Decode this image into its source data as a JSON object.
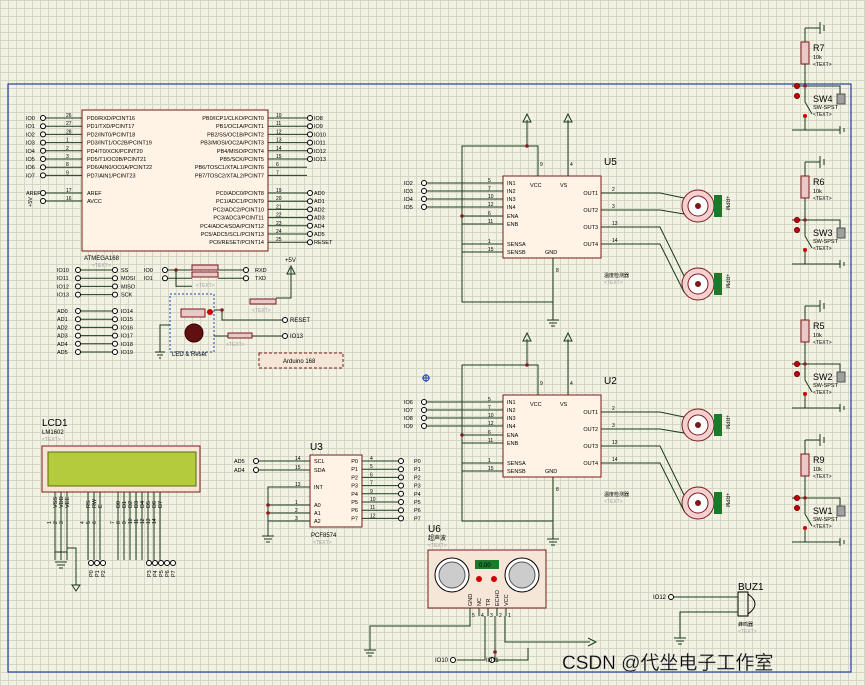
{
  "frame_color": "#1f3f9f",
  "arduino": {
    "part": "ATMEGA168",
    "tag": "<TEXT>",
    "left_pins": [
      {
        "net": "IO0",
        "num": "26",
        "name": "PD0/RXD/PCINT16"
      },
      {
        "net": "IO1",
        "num": "27",
        "name": "PD1/TXD/PCINT17"
      },
      {
        "net": "IO2",
        "num": "28",
        "name": "PD2/INT0/PCINT18"
      },
      {
        "net": "IO3",
        "num": "1",
        "name": "PD3/INT1/OC2B/PCINT19"
      },
      {
        "net": "IO4",
        "num": "2",
        "name": "PD4/T0/XCK/PCINT20"
      },
      {
        "net": "IO5",
        "num": "3",
        "name": "PD5/T1/OC0B/PCINT21"
      },
      {
        "net": "IO6",
        "num": "8",
        "name": "PD6/AIN0/OC0A/PCINT22"
      },
      {
        "net": "IO7",
        "num": "9",
        "name": "PD7/AIN1/PCINT23"
      },
      {
        "net": "AREF",
        "num": "17",
        "name": "AREF"
      },
      {
        "net": "+5V",
        "num": "16",
        "name": "AVCC"
      }
    ],
    "right_pins": [
      {
        "net": "IO8",
        "num": "10",
        "name": "PB0/ICP1/CLKO/PCINT0"
      },
      {
        "net": "IO9",
        "num": "11",
        "name": "PB1/OC1A/PCINT1"
      },
      {
        "net": "IO10",
        "num": "12",
        "name": "PB2/SS/OC1B/PCINT2"
      },
      {
        "net": "IO11",
        "num": "13",
        "name": "PB3/MOSI/OC2A/PCINT3"
      },
      {
        "net": "IO12",
        "num": "14",
        "name": "PB4/MISO/PCINT4"
      },
      {
        "net": "IO13",
        "num": "15",
        "name": "PB5/SCK/PCINT5"
      },
      {
        "net": "",
        "num": "6",
        "name": "PB6/TOSC1/XTAL1/PCINT6"
      },
      {
        "net": "",
        "num": "7",
        "name": "PB7/TOSC2/XTAL2/PCINT7"
      },
      {
        "net": "AD0",
        "num": "19",
        "name": "PC0/ADC0/PCINT8"
      },
      {
        "net": "AD1",
        "num": "20",
        "name": "PC1/ADC1/PCINT9"
      },
      {
        "net": "AD2",
        "num": "21",
        "name": "PC2/ADC2/PCINT10"
      },
      {
        "net": "AD3",
        "num": "22",
        "name": "PC3/ADC3/PCINT11"
      },
      {
        "net": "AD4",
        "num": "23",
        "name": "PC4/ADC4/SDA/PCINT12"
      },
      {
        "net": "AD5",
        "num": "24",
        "name": "PC5/ADC5/SCL/PCINT13"
      },
      {
        "net": "RESET",
        "num": "25",
        "name": "PC6/RESET/PCINT14"
      }
    ],
    "spi_map": [
      {
        "from": "IO10",
        "to": "SS"
      },
      {
        "from": "IO11",
        "to": "MOSI"
      },
      {
        "from": "IO12",
        "to": "MISO"
      },
      {
        "from": "IO13",
        "to": "SCK"
      }
    ],
    "uart_map": [
      {
        "from": "IO0",
        "to": "RXD"
      },
      {
        "from": "IO1",
        "to": "TXD"
      }
    ],
    "analog_map": [
      {
        "from": "AD0",
        "to": "IO14"
      },
      {
        "from": "AD1",
        "to": "IO15"
      },
      {
        "from": "AD2",
        "to": "IO16"
      },
      {
        "from": "AD3",
        "to": "IO17"
      },
      {
        "from": "AD4",
        "to": "IO18"
      },
      {
        "from": "AD5",
        "to": "IO19"
      }
    ],
    "plus5v": "+5V",
    "reset": "RESET",
    "io13": "IO13",
    "led_reset_label": "LED & Reset",
    "board_label": "Arduino 168",
    "text_tag": "<TEXT>"
  },
  "u5": {
    "ref": "U5",
    "title": "温度检测器",
    "tag": "<TEXT>",
    "inputs": [
      "IO2",
      "IO3",
      "IO4",
      "IO5"
    ],
    "left_pins": [
      {
        "num": "5",
        "name": "IN1"
      },
      {
        "num": "7",
        "name": "IN2"
      },
      {
        "num": "10",
        "name": "IN3"
      },
      {
        "num": "12",
        "name": "IN4"
      },
      {
        "num": "6",
        "name": "ENA"
      },
      {
        "num": "11",
        "name": "ENB"
      },
      {
        "num": "1",
        "name": "SENSA"
      },
      {
        "num": "15",
        "name": "SENSB"
      }
    ],
    "top_pins": [
      {
        "num": "9",
        "name": "VCC"
      },
      {
        "num": "4",
        "name": "VS"
      }
    ],
    "right_pins": [
      {
        "num": "2",
        "name": "OUT1"
      },
      {
        "num": "3",
        "name": "OUT2"
      },
      {
        "num": "13",
        "name": "OUT3"
      },
      {
        "num": "14",
        "name": "OUT4"
      }
    ],
    "gnd": {
      "num": "8",
      "name": "GND"
    },
    "motor_label": "+RPM"
  },
  "u2": {
    "ref": "U2",
    "title": "温度检测器",
    "tag": "<TEXT>",
    "inputs": [
      "IO6",
      "IO7",
      "IO8",
      "IO9"
    ],
    "left_pins": [
      {
        "num": "5",
        "name": "IN1"
      },
      {
        "num": "7",
        "name": "IN2"
      },
      {
        "num": "10",
        "name": "IN3"
      },
      {
        "num": "12",
        "name": "IN4"
      },
      {
        "num": "6",
        "name": "ENA"
      },
      {
        "num": "11",
        "name": "ENB"
      },
      {
        "num": "1",
        "name": "SENSA"
      },
      {
        "num": "15",
        "name": "SENSB"
      }
    ],
    "top_pins": [
      {
        "num": "9",
        "name": "VCC"
      },
      {
        "num": "4",
        "name": "VS"
      }
    ],
    "right_pins": [
      {
        "num": "2",
        "name": "OUT1"
      },
      {
        "num": "3",
        "name": "OUT2"
      },
      {
        "num": "13",
        "name": "OUT3"
      },
      {
        "num": "14",
        "name": "OUT4"
      }
    ],
    "gnd": {
      "num": "8",
      "name": "GND"
    },
    "motor_label": "+RPM"
  },
  "lcd": {
    "ref": "LCD1",
    "part": "LM1602",
    "tag": "<TEXT>",
    "pins": [
      {
        "name": "VSS",
        "num": "1"
      },
      {
        "name": "VDD",
        "num": "2"
      },
      {
        "name": "VEE",
        "num": "3"
      },
      {
        "name": "RS",
        "num": "4"
      },
      {
        "name": "RW",
        "num": "5"
      },
      {
        "name": "E",
        "num": "6"
      },
      {
        "name": "D0",
        "num": "7"
      },
      {
        "name": "D1",
        "num": "8"
      },
      {
        "name": "D2",
        "num": "9"
      },
      {
        "name": "D3",
        "num": "10"
      },
      {
        "name": "D4",
        "num": "11"
      },
      {
        "name": "D5",
        "num": "12"
      },
      {
        "name": "D6",
        "num": "13"
      },
      {
        "name": "D7",
        "num": "14"
      }
    ],
    "bottom_nets": [
      "P0",
      "P1",
      "P2",
      "P3",
      "P4",
      "P5",
      "P6",
      "P7"
    ],
    "screen_color": "#b4cc3c"
  },
  "u3": {
    "ref": "U3",
    "part": "PCF8574",
    "tag": "<TEXT>",
    "left_nets": [
      "AD5",
      "AD4"
    ],
    "left_pins": [
      {
        "num": "14",
        "name": "SCL"
      },
      {
        "num": "15",
        "name": "SDA"
      },
      {
        "num": "13",
        "name": "INT"
      },
      {
        "num": "1",
        "name": "A0"
      },
      {
        "num": "2",
        "name": "A1"
      },
      {
        "num": "3",
        "name": "A2"
      }
    ],
    "right_pins": [
      {
        "num": "4",
        "name": "P0"
      },
      {
        "num": "5",
        "name": "P1"
      },
      {
        "num": "6",
        "name": "P2"
      },
      {
        "num": "7",
        "name": "P3"
      },
      {
        "num": "9",
        "name": "P4"
      },
      {
        "num": "10",
        "name": "P5"
      },
      {
        "num": "11",
        "name": "P6"
      },
      {
        "num": "12",
        "name": "P7"
      }
    ],
    "right_nets": [
      "P0",
      "P1",
      "P2",
      "P3",
      "P4",
      "P5",
      "P6",
      "P7"
    ]
  },
  "u6": {
    "ref": "U6",
    "title": "超声波",
    "tag": "<TEXT>",
    "pins": [
      {
        "name": "GND",
        "num": "5"
      },
      {
        "name": "NC",
        "num": "4"
      },
      {
        "name": "TR",
        "num": "3"
      },
      {
        "name": "ECHO",
        "num": "2"
      },
      {
        "name": "VCC",
        "num": "1"
      }
    ],
    "display": "0.00",
    "nets": [
      "IO10",
      "IO11"
    ]
  },
  "buzzer": {
    "ref": "BUZ1",
    "label": "蜂鸣器",
    "tag": "<TEXT>",
    "net": "IO12"
  },
  "switches": [
    {
      "r": "R7",
      "rv": "10k",
      "sw": "SW4",
      "swtype": "SW-SPST",
      "tag": "<TEXT>"
    },
    {
      "r": "R6",
      "rv": "10k",
      "sw": "SW3",
      "swtype": "SW-SPST",
      "tag": "<TEXT>"
    },
    {
      "r": "R5",
      "rv": "10k",
      "sw": "SW2",
      "swtype": "SW-SPST",
      "tag": "<TEXT>"
    },
    {
      "r": "R9",
      "rv": "10k",
      "sw": "SW1",
      "swtype": "SW-SPST",
      "tag": "<TEXT>"
    }
  ],
  "watermark": "CSDN @代坐电子工作室"
}
